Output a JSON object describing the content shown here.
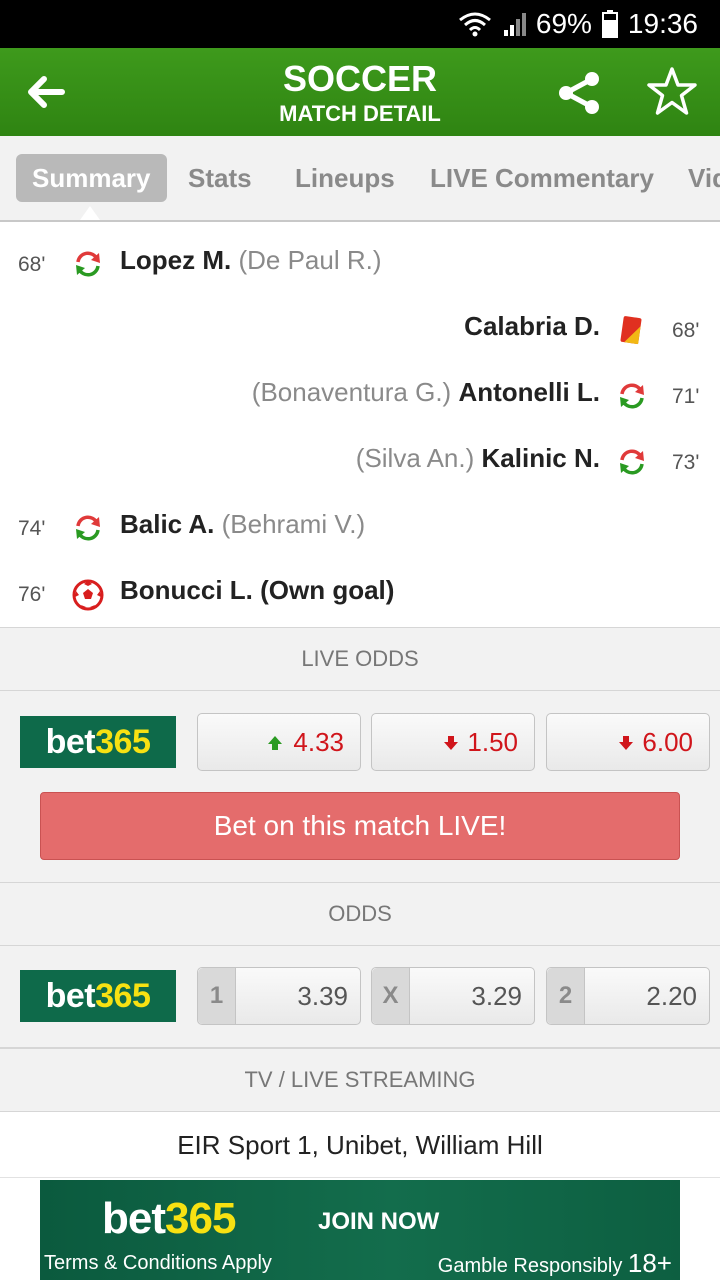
{
  "status_bar": {
    "battery": "69%",
    "time": "19:36"
  },
  "header": {
    "title": "SOCCER",
    "subtitle": "MATCH DETAIL"
  },
  "tabs": [
    {
      "label": "Summary",
      "active": true
    },
    {
      "label": "Stats"
    },
    {
      "label": "Lineups"
    },
    {
      "label": "LIVE Commentary"
    },
    {
      "label": "Vid"
    }
  ],
  "incidents": [
    {
      "minute": "68'",
      "side": "home",
      "type": "substitution",
      "player": "Lopez M.",
      "assist": "(De Paul R.)"
    },
    {
      "minute": "68'",
      "side": "away",
      "type": "red-card",
      "player": "Calabria D.",
      "assist": ""
    },
    {
      "minute": "71'",
      "side": "away",
      "type": "substitution",
      "player": "Antonelli L.",
      "assist": "(Bonaventura G.)"
    },
    {
      "minute": "73'",
      "side": "away",
      "type": "substitution",
      "player": "Kalinic N.",
      "assist": "(Silva An.)"
    },
    {
      "minute": "74'",
      "side": "home",
      "type": "substitution",
      "player": "Balic A.",
      "assist": "(Behrami V.)"
    },
    {
      "minute": "76'",
      "side": "home",
      "type": "own-goal",
      "player": "Bonucci L. (Own goal)",
      "assist": ""
    }
  ],
  "live_odds": {
    "heading": "LIVE ODDS",
    "bookmaker": {
      "part1": "bet",
      "part2": "365"
    },
    "values": [
      {
        "value": "4.33",
        "trend": "up"
      },
      {
        "value": "1.50",
        "trend": "down"
      },
      {
        "value": "6.00",
        "trend": "down"
      }
    ],
    "bet_button": "Bet on this match LIVE!"
  },
  "odds": {
    "heading": "ODDS",
    "bookmaker": {
      "part1": "bet",
      "part2": "365"
    },
    "values": [
      {
        "label": "1",
        "value": "3.39"
      },
      {
        "label": "X",
        "value": "3.29"
      },
      {
        "label": "2",
        "value": "2.20"
      }
    ]
  },
  "tv": {
    "heading": "TV / LIVE STREAMING",
    "channels": "EIR Sport 1, Unibet, William Hill"
  },
  "banner": {
    "logo_part1": "bet",
    "logo_part2": "365",
    "cta": "JOIN NOW",
    "terms": "Terms & Conditions Apply",
    "gamble": "Gamble Responsibly",
    "age": "18+"
  },
  "colors": {
    "header_green": "#3e9a1c",
    "bet365_green": "#0e6a4a",
    "bet365_yellow": "#f7e112",
    "odds_red": "#d0151b",
    "odds_up_green": "#2a9a22",
    "live_button": "#e46c6c"
  }
}
